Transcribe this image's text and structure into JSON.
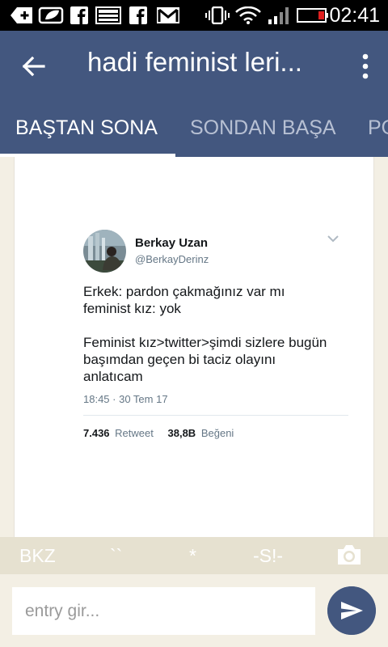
{
  "status_bar": {
    "time": "02:41",
    "icons": [
      "tab-add-icon",
      "leaf-icon",
      "facebook-icon",
      "image-icon",
      "facebook-icon",
      "gmail-icon",
      "vibrate-icon",
      "wifi-icon",
      "signal-icon",
      "battery-icon"
    ]
  },
  "app_bar": {
    "title": "hadi feminist leri...",
    "back_icon": "arrow-back-icon",
    "menu_icon": "more-vert-icon"
  },
  "tabs": [
    {
      "label": "BAŞTAN SONA",
      "active": true
    },
    {
      "label": "SONDAN BAŞA",
      "active": false
    },
    {
      "label": "PO",
      "active": false
    }
  ],
  "tweet": {
    "name": "Berkay Uzan",
    "handle": "@BerkayDerinz",
    "lines": [
      "Erkek: pardon çakmağınız var mı",
      "feminist kız: yok",
      "",
      "Feminist kız>twitter>şimdi sizlere bugün",
      "başımdan geçen bi taciz olayını",
      "anlatıcam"
    ],
    "timestamp": "18:45 · 30 Tem 17",
    "retweets_count": "7.436",
    "retweets_label": "Retweet",
    "likes_count": "38,8B",
    "likes_label": "Beğeni"
  },
  "toolbar": {
    "bkz": "BKZ",
    "quote": "``",
    "star": "*",
    "spoiler": "-S!-",
    "camera_icon": "camera-icon"
  },
  "input": {
    "placeholder": "entry gir...",
    "value": "",
    "send_icon": "send-icon"
  },
  "colors": {
    "primary": "#43577f",
    "toolbar_bg": "#e6e1d0",
    "page_bg": "#f3efe4",
    "tab_inactive": "#b7c0d3"
  }
}
